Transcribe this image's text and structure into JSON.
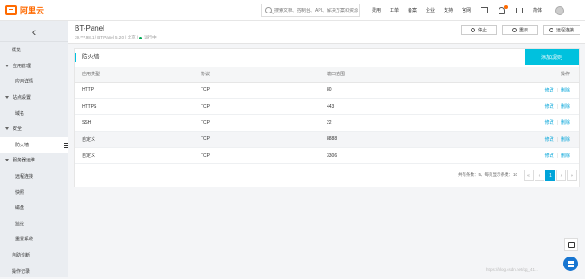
{
  "topbar": {
    "logo_text": "阿里云",
    "search_placeholder": "搜索文档、控制台、API、解决方案和资源",
    "nav": [
      "费用",
      "工单",
      "备案",
      "企业",
      "支持",
      "官网"
    ],
    "lang": "简体"
  },
  "sidebar": {
    "items": [
      {
        "label": "概览",
        "kind": "item"
      },
      {
        "label": "应用管理",
        "kind": "group"
      },
      {
        "label": "应用详情",
        "kind": "sub"
      },
      {
        "label": "站点设置",
        "kind": "group"
      },
      {
        "label": "域名",
        "kind": "sub"
      },
      {
        "label": "安全",
        "kind": "group"
      },
      {
        "label": "防火墙",
        "kind": "sub",
        "active": true
      },
      {
        "label": "服务器运维",
        "kind": "group"
      },
      {
        "label": "远程连接",
        "kind": "sub"
      },
      {
        "label": "快照",
        "kind": "sub"
      },
      {
        "label": "磁盘",
        "kind": "sub"
      },
      {
        "label": "监控",
        "kind": "sub"
      },
      {
        "label": "重置系统",
        "kind": "sub"
      },
      {
        "label": "自助诊断",
        "kind": "item"
      },
      {
        "label": "操作记录",
        "kind": "item"
      }
    ]
  },
  "header": {
    "title": "BT-Panel",
    "sub_left": "39.***.98.1 / BT-Panel 5.2.0 | 北京 |",
    "status": "运行中",
    "buttons": {
      "stop": "停止",
      "restart": "重启",
      "remote": "远程连接"
    }
  },
  "panel": {
    "title": "防火墙",
    "add_button": "添加规则",
    "columns": [
      "应用类型",
      "协议",
      "端口范围",
      "操作"
    ],
    "rows": [
      {
        "type": "HTTP",
        "protocol": "TCP",
        "port": "80",
        "edit": "修改",
        "delete": "删除"
      },
      {
        "type": "HTTPS",
        "protocol": "TCP",
        "port": "443",
        "edit": "修改",
        "delete": "删除"
      },
      {
        "type": "SSH",
        "protocol": "TCP",
        "port": "22",
        "edit": "修改",
        "delete": "删除"
      },
      {
        "type": "自定义",
        "protocol": "TCP",
        "port": "8888",
        "edit": "修改",
        "delete": "删除"
      },
      {
        "type": "自定义",
        "protocol": "TCP",
        "port": "3306",
        "edit": "修改",
        "delete": "删除"
      }
    ],
    "pager": {
      "summary": "共有条数：5，每页显示条数：10",
      "first": "«",
      "prev": "‹",
      "current": "1",
      "next": "›",
      "last": "»"
    }
  },
  "watermark": "https://blog.csdn.net/qq_41..."
}
